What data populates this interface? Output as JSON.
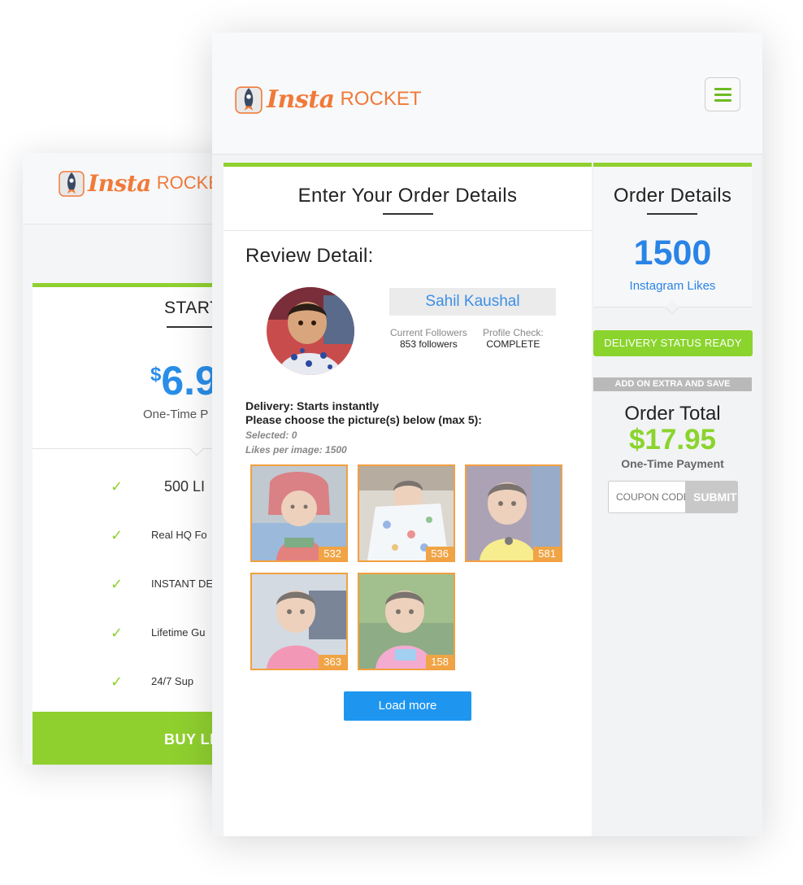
{
  "brand": {
    "insta": "Insta",
    "rocket": "ROCKET"
  },
  "back_card": {
    "title": "START",
    "price_currency": "$",
    "price_value": "6.9",
    "price_sub": "One-Time P",
    "features": [
      "500 LI",
      "Real HQ Fo",
      "INSTANT DE",
      "Lifetime Gu",
      "24/7 Sup"
    ],
    "buy_label": "BUY LI"
  },
  "main": {
    "menu_icon": "hamburger-menu-icon",
    "order_title": "Enter Your Order Details",
    "review_title": "Review Detail:",
    "profile": {
      "name": "Sahil Kaushal",
      "followers_label": "Current Followers",
      "followers_value": "853 followers",
      "check_label": "Profile Check:",
      "check_value": "COMPLETE"
    },
    "delivery_line": "Delivery: Starts instantly",
    "choose_line": "Please choose the picture(s) below (max 5):",
    "selected": "Selected: 0",
    "likes_per_image": "Likes per image: 1500",
    "images": [
      {
        "count": "532"
      },
      {
        "count": "536"
      },
      {
        "count": "581"
      },
      {
        "count": "363"
      },
      {
        "count": "158"
      }
    ],
    "load_more": "Load more"
  },
  "sidebar": {
    "title": "Order Details",
    "quantity": "1500",
    "unit": "Instagram Likes",
    "status": "DELIVERY STATUS READY",
    "extra": "ADD ON EXTRA AND SAVE",
    "total_label": "Order Total",
    "total_value": "$17.95",
    "payment_type": "One-Time Payment",
    "coupon_placeholder": "COUPON CODE",
    "submit": "SUBMIT"
  },
  "colors": {
    "accent_green": "#8fd02f",
    "brand_orange": "#f07a3a",
    "link_blue": "#2a84e6",
    "button_blue": "#1e96f0"
  }
}
